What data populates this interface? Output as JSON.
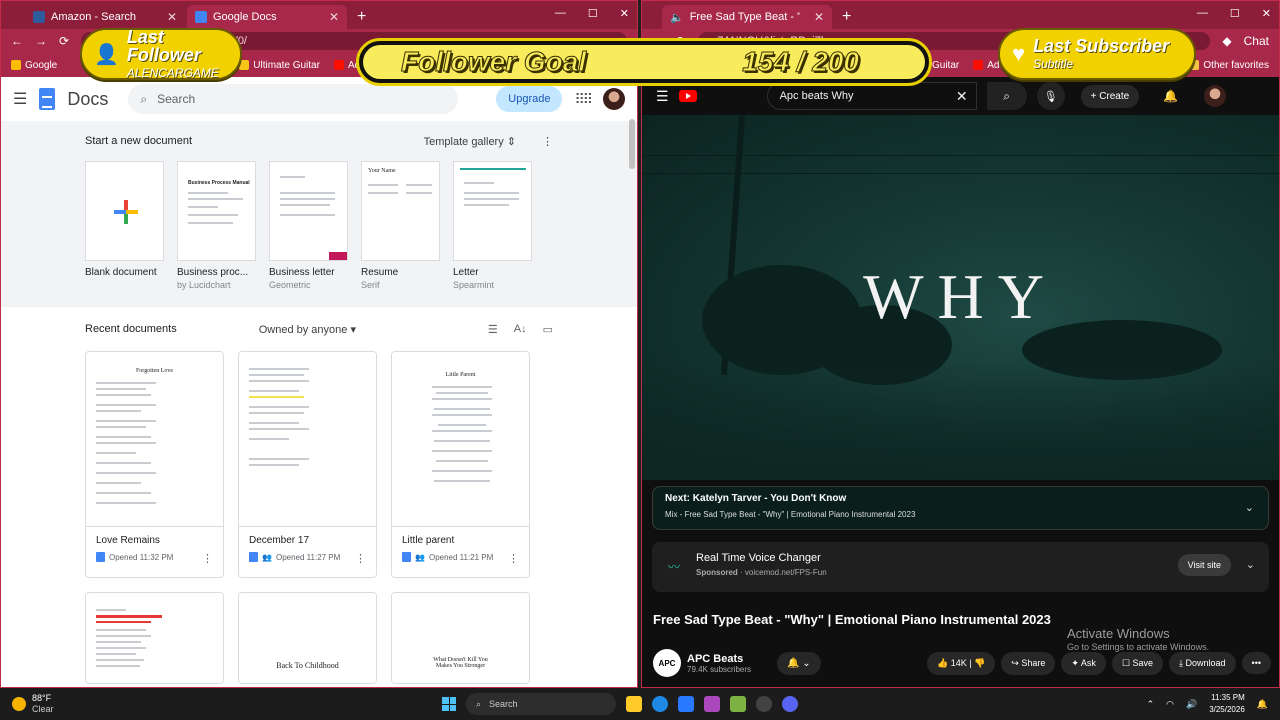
{
  "left_browser": {
    "tabs": [
      {
        "title": "Amazon - Search",
        "active": false
      },
      {
        "title": "Google Docs",
        "active": true
      }
    ],
    "url": "docs.google.com/document/u/0/",
    "bookmarks": [
      "Google",
      "Ultimate Guitar",
      "Adob"
    ],
    "tab_close": "✕",
    "new_tab": "+",
    "nav": {
      "back": "←",
      "forward": "→",
      "reload": "⟳"
    },
    "window_controls": [
      "—",
      "☐",
      "✕"
    ]
  },
  "docs": {
    "app_name": "Docs",
    "search_placeholder": "Search",
    "upgrade_label": "Upgrade",
    "start_new": "Start a new document",
    "template_gallery": "Template gallery",
    "templates": [
      {
        "name": "Blank document",
        "sub": ""
      },
      {
        "name": "Business proc...",
        "sub": "by Lucidchart"
      },
      {
        "name": "Business letter",
        "sub": "Geometric"
      },
      {
        "name": "Resume",
        "sub": "Serif"
      },
      {
        "name": "Letter",
        "sub": "Spearmint"
      }
    ],
    "template_thumb_text": [
      "Business Process Manual",
      "Your Name"
    ],
    "recent_title": "Recent documents",
    "owned_by": "Owned by anyone",
    "recent_docs": [
      {
        "title": "Love Remains",
        "opened": "Opened 11:32 PM",
        "thumb_title": "Forgotten Love"
      },
      {
        "title": "December 17",
        "opened": "Opened 11:27 PM",
        "thumb_title": ""
      },
      {
        "title": "Little parent",
        "opened": "Opened 11:21 PM",
        "thumb_title": "Little Parent"
      }
    ],
    "more_doc_thumbs": [
      "",
      "Back To Childhood",
      "What Doesn't Kill You Makes You Stronger"
    ]
  },
  "right_browser": {
    "tab_title": "Free Sad Type Beat - \"Why\" | E",
    "url": "...7ANNQU&list=RD_j7bo...",
    "bookmarks": [
      "Guitar",
      "Adob",
      "Other favorites"
    ],
    "tab_close": "✕",
    "new_tab": "+",
    "window_controls": [
      "—",
      "☐",
      "✕"
    ],
    "chat_label": "Chat"
  },
  "youtube": {
    "search_value": "Apc beats Why",
    "create_label": "Create",
    "video_overlay_text": "WHY",
    "next_label": "Next: Katelyn Tarver - You Don't Know",
    "next_sub": "Mix - Free Sad Type Beat - \"Why\" | Emotional Piano Instrumental 2023",
    "ad_title": "Real Time Voice Changer",
    "ad_sponsored": "Sponsored",
    "ad_url": "voicemod.net/FPS-Fun",
    "visit_site": "Visit site",
    "video_title": "Free Sad Type Beat - \"Why\" | Emotional Piano Instrumental 2023",
    "channel_avatar": "APC",
    "channel_name": "APC Beats",
    "subscribers": "79.4K subscribers",
    "likes": "14K",
    "share": "Share",
    "ask": "Ask",
    "save": "Save",
    "download": "Download",
    "more": "•••"
  },
  "watermark": {
    "title": "Activate Windows",
    "sub": "Go to Settings to activate Windows."
  },
  "overlays": {
    "last_follower_label": "Last Follower",
    "last_follower_name": "ALENCARGAME",
    "goal_label": "Follower Goal",
    "goal_value": "154 / 200",
    "goal_current": 154,
    "goal_target": 200,
    "last_subscriber_label": "Last Subscriber",
    "last_subscriber_name": "Subtitle"
  },
  "taskbar": {
    "temp": "88°F",
    "weather": "Clear",
    "search": "Search",
    "time": "11:35 PM",
    "date": "3/25/2026"
  },
  "colors": {
    "browser_frame": "#8d1e3a",
    "overlay_yellow": "#f2d100",
    "docs_blue": "#4285f4",
    "yt_red": "#ff0000"
  }
}
